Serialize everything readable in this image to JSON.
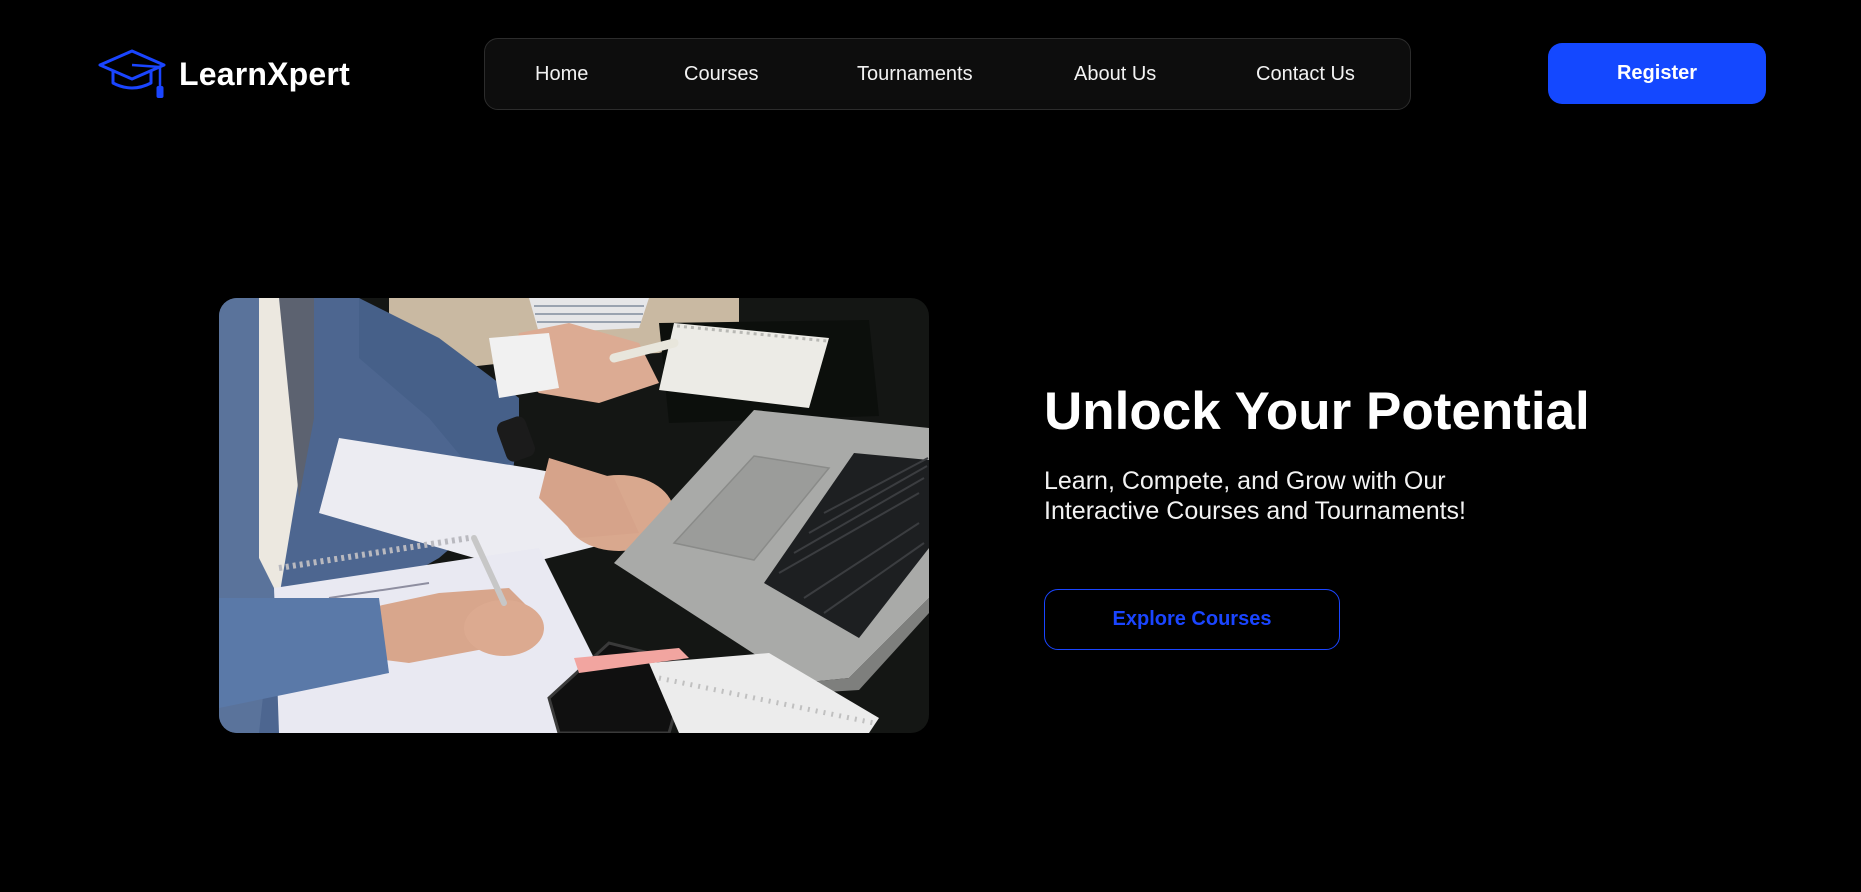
{
  "header": {
    "brand_name": "LearnXpert",
    "logo_icon": "graduation-cap-icon",
    "nav": {
      "home": "Home",
      "courses": "Courses",
      "tournaments": "Tournaments",
      "about": "About Us",
      "contact": "Contact Us"
    },
    "register_label": "Register"
  },
  "hero": {
    "title": "Unlock Your Potential",
    "subtitle": "Learn, Compete, and Grow with Our Interactive Courses and Tournaments!",
    "cta_label": "Explore Courses",
    "image": "people-studying-with-laptop-photo"
  },
  "colors": {
    "background": "#000000",
    "accent": "#1448ff",
    "nav_background": "#0d0d0d",
    "text": "#ffffff"
  }
}
